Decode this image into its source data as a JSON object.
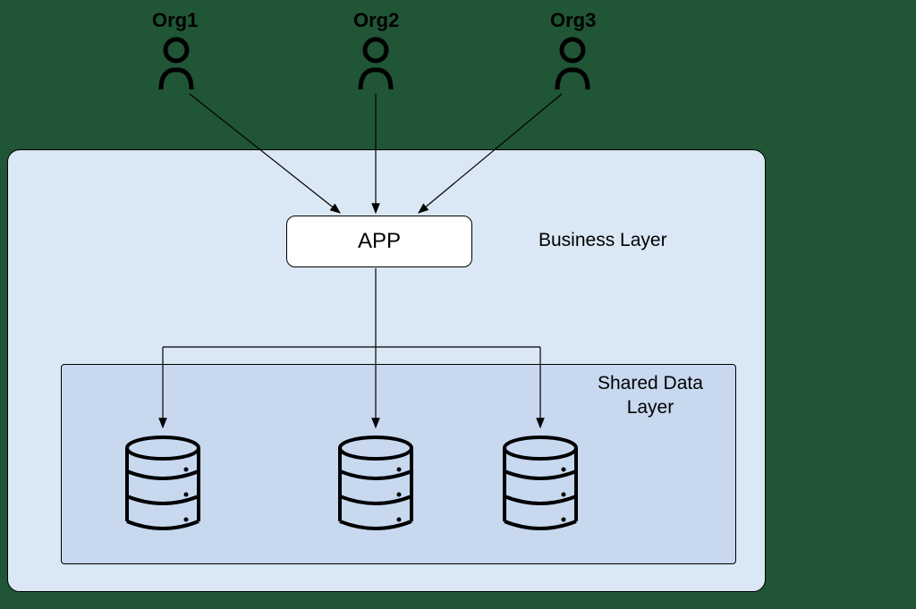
{
  "orgs": [
    {
      "label": "Org1"
    },
    {
      "label": "Org2"
    },
    {
      "label": "Org3"
    }
  ],
  "app_label": "APP",
  "business_layer_label": "Business Layer",
  "data_layer_label": "Shared Data\nLayer"
}
